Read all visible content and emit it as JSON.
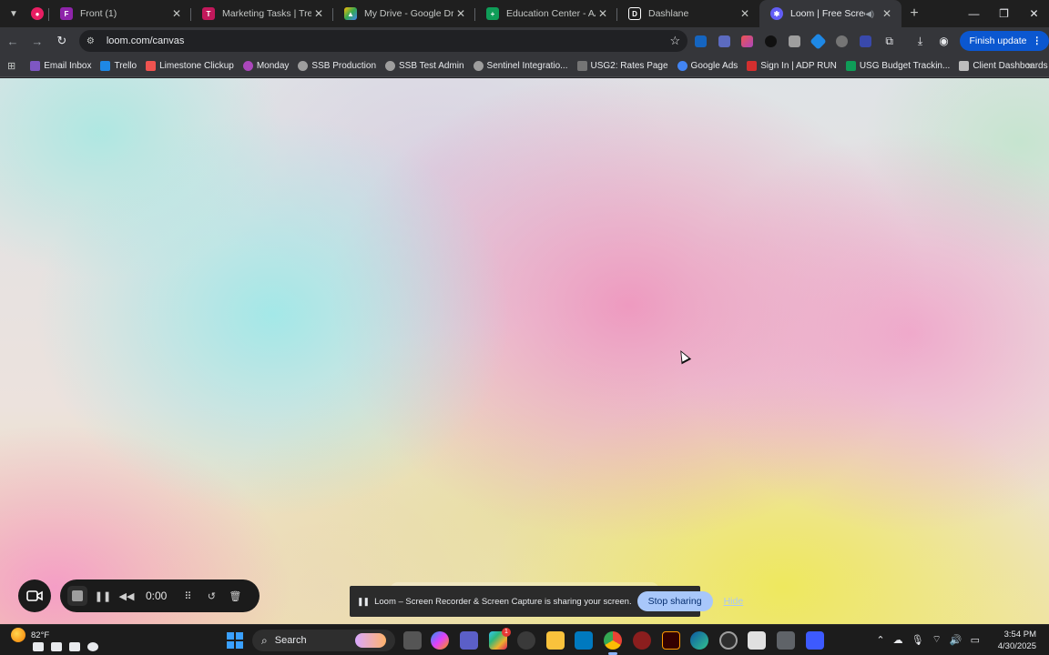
{
  "tabs": [
    {
      "title": "",
      "icon": "loom-record-icon",
      "color": "#e91e63"
    },
    {
      "title": "Front (1)",
      "icon": "front-icon",
      "color": "#8e24aa"
    },
    {
      "title": "Marketing Tasks | Trello",
      "icon": "trello-icon",
      "color": "#c2185b"
    },
    {
      "title": "My Drive - Google Drive",
      "icon": "google-drive-icon",
      "color": "#34a853"
    },
    {
      "title": "Education Center - AACJ - G",
      "icon": "google-sheets-icon",
      "color": "#0f9d58"
    },
    {
      "title": "Dashlane",
      "icon": "dashlane-icon",
      "color": "#ffffff"
    },
    {
      "title": "Loom | Free Screen & Vi",
      "icon": "loom-icon",
      "color": "#625df5",
      "active": true
    }
  ],
  "toolbar": {
    "url": "loom.com/canvas",
    "finish_update": "Finish update"
  },
  "bookmarks": [
    {
      "label": "Email Inbox",
      "color": "#7e57c2"
    },
    {
      "label": "Trello",
      "color": "#1e88e5"
    },
    {
      "label": "Limestone Clickup",
      "color": "#ef5350"
    },
    {
      "label": "Monday",
      "color": "#ab47bc"
    },
    {
      "label": "SSB Production",
      "color": "#9e9e9e"
    },
    {
      "label": "SSB Test Admin",
      "color": "#9e9e9e"
    },
    {
      "label": "Sentinel Integratio...",
      "color": "#9e9e9e"
    },
    {
      "label": "USG2: Rates Page",
      "color": "#757575"
    },
    {
      "label": "Google Ads",
      "color": "#4285f4"
    },
    {
      "label": "Sign In | ADP RUN",
      "color": "#d32f2f"
    },
    {
      "label": "USG Budget Trackin...",
      "color": "#0f9d58"
    },
    {
      "label": "Client Dashboards",
      "color": "#bdbdbd"
    }
  ],
  "loom": {
    "timer": "0:00",
    "banner_message": "Loom – Screen Recorder & Screen Capture is sharing your screen.",
    "stop_sharing": "Stop sharing",
    "hide": "Hide"
  },
  "taskbar": {
    "temperature": "82°F",
    "search_label": "Search",
    "time": "3:54 PM",
    "date": "4/30/2025",
    "notification_count": "1"
  }
}
